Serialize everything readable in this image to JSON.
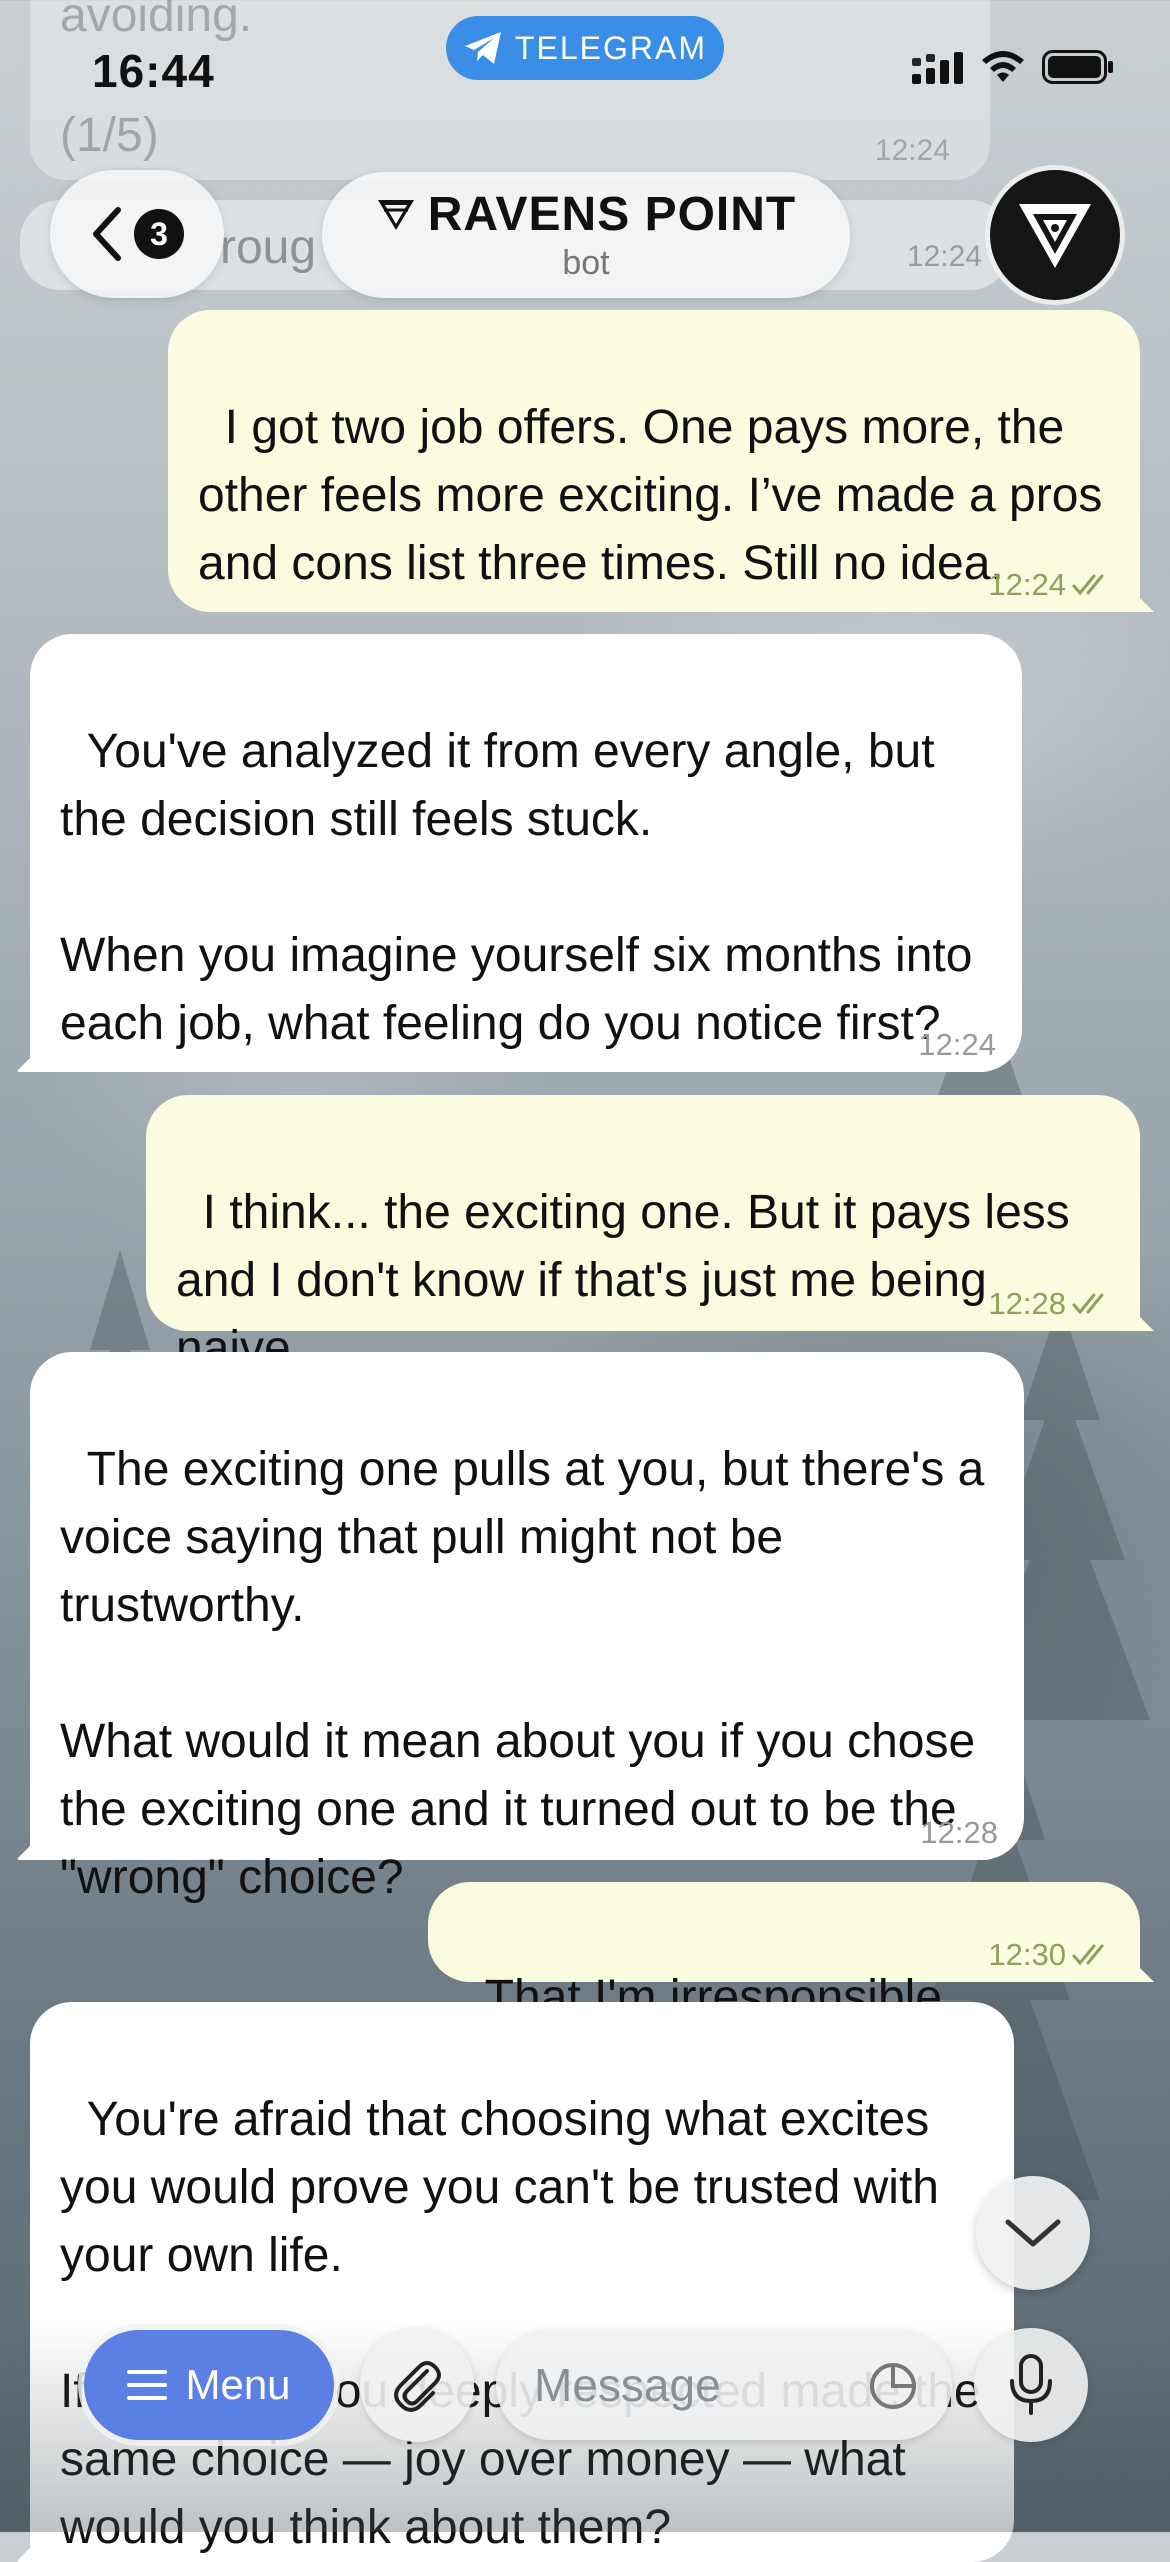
{
  "status_bar": {
    "time": "16:44",
    "return_app": "TELEGRAM"
  },
  "header": {
    "back_badge": "3",
    "title": "RAVENS POINT",
    "subtitle": "bot"
  },
  "ghost": {
    "top_line": "avoiding.",
    "counter": "(1/5)",
    "counter_time": "12:24",
    "partial_text": "roug",
    "partial_time": "12:24"
  },
  "messages": [
    {
      "dir": "out",
      "text": "I got two job offers. One pays more, the other feels more exciting. I’ve made a pros and cons list three times. Still no idea.",
      "time": "12:24"
    },
    {
      "dir": "in",
      "text": "You've analyzed it from every angle, but the decision still feels stuck.\n\nWhen you imagine yourself six months into each job, what feeling do you notice first?",
      "time": "12:24"
    },
    {
      "dir": "out",
      "text": "I think... the exciting one. But it pays less and I don't know if that's just me being naive.",
      "time": "12:28"
    },
    {
      "dir": "in",
      "text": "The exciting one pulls at you, but there's a voice saying that pull might not be trustworthy.\n\nWhat would it mean about you if you chose the exciting one and it turned out to be the \"wrong\" choice?",
      "time": "12:28"
    },
    {
      "dir": "out",
      "text": "That I'm irresponsible.",
      "time": "12:30"
    },
    {
      "dir": "in",
      "text": "You're afraid that choosing what excites you would prove you can't be trusted with your own life.\n\nIf someone you deeply respected made the same choice — joy over money — what would you think about them?",
      "time": ""
    }
  ],
  "composer": {
    "menu_label": "Menu",
    "placeholder": "Message"
  },
  "colors": {
    "incoming": "#ffffff",
    "outgoing": "#fbfbdf",
    "accent": "#5b7fe3",
    "telegram": "#3a8ee6"
  },
  "icons": [
    "telegram-plane-icon",
    "signal-icon",
    "wifi-icon",
    "battery-icon",
    "back-chevron-icon",
    "ravens-logo-icon",
    "read-checks-icon",
    "chevron-down-icon",
    "menu-lines-icon",
    "paperclip-icon",
    "sticker-icon",
    "microphone-icon"
  ]
}
